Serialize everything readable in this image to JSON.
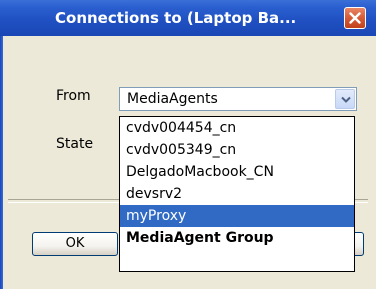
{
  "window": {
    "title": "Connections to (Laptop Ba..."
  },
  "form": {
    "from_label": "From",
    "state_label": "State"
  },
  "from_select": {
    "value": "MediaAgents",
    "options": [
      {
        "label": "cvdv004454_cn"
      },
      {
        "label": "cvdv005349_cn"
      },
      {
        "label": "DelgadoMacbook_CN"
      },
      {
        "label": "devsrv2"
      },
      {
        "label": "myProxy",
        "selected": true
      },
      {
        "label": "MediaAgent Group",
        "bold": true
      }
    ]
  },
  "buttons": {
    "ok_label": "OK"
  },
  "colors": {
    "titlebar": "#1f4fc1",
    "selection": "#316ac5",
    "dialog_bg": "#ece9d8",
    "close": "#d65a36"
  },
  "icons": {
    "close": "close-icon",
    "dropdown": "chevron-down-icon"
  }
}
